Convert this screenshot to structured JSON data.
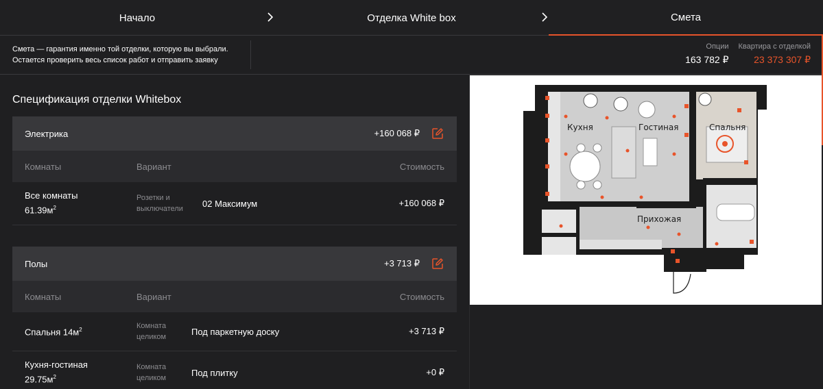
{
  "steps": [
    {
      "label": "Начало"
    },
    {
      "label": "Отделка White box"
    },
    {
      "label": "Смета"
    }
  ],
  "info": {
    "line1": "Смета — гарантия именно той отделки, которую вы выбрали.",
    "line2": "Остается проверить весь список работ и отправить заявку"
  },
  "totals": {
    "options_label": "Опции",
    "options_value": "163 782 ₽",
    "apartment_label": "Квартира с отделкой",
    "apartment_value": "23 373 307 ₽"
  },
  "spec": {
    "title": "Спецификация отделки Whitebox",
    "columns": {
      "room": "Комнаты",
      "variant": "Вариант",
      "cost": "Стоимость"
    },
    "sections": [
      {
        "name": "Электрика",
        "sum": "+160 068 ₽",
        "rows": [
          {
            "room": "Все комнаты",
            "area": "61.39м",
            "area_sup": "2",
            "var_label_1": "Розетки и",
            "var_label_2": "выключатели",
            "variant": "02 Максимум",
            "cost": "+160 068 ₽"
          }
        ]
      },
      {
        "name": "Полы",
        "sum": "+3 713 ₽",
        "rows": [
          {
            "room": "Спальня 14м",
            "area_sup": "2",
            "var_label_1": "Комната",
            "var_label_2": "целиком",
            "variant": "Под паркетную доску",
            "cost": "+3 713 ₽"
          },
          {
            "room": "Кухня-гостиная",
            "area": "29.75м",
            "area_sup": "2",
            "var_label_1": "Комната",
            "var_label_2": "целиком",
            "variant": "Под плитку",
            "cost": "+0 ₽"
          }
        ]
      }
    ]
  },
  "plan": {
    "rooms": {
      "kitchen": "Кухня",
      "living": "Гостиная",
      "bedroom": "Спальня",
      "hall": "Прихожая"
    }
  },
  "colors": {
    "accent": "#e8542a",
    "background": "#1f1f21",
    "section_head": "#38383b",
    "column_head": "#2b2b2e"
  }
}
